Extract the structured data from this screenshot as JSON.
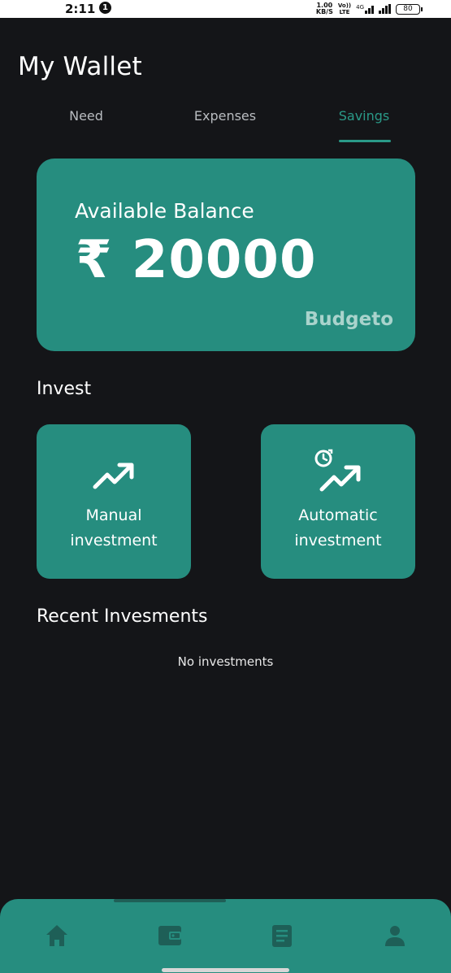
{
  "status_bar": {
    "time": "2:11",
    "notification_count": "1",
    "net_speed_value": "1.00",
    "net_speed_unit": "KB/S",
    "volte_top": "Vo))",
    "volte_bottom": "LTE",
    "network_type": "4G",
    "battery": "80"
  },
  "header": {
    "title": "My Wallet"
  },
  "tabs": [
    {
      "label": "Need",
      "active": false
    },
    {
      "label": "Expenses",
      "active": false
    },
    {
      "label": "Savings",
      "active": true
    }
  ],
  "balance_card": {
    "label": "Available Balance",
    "amount": "₹ 20000",
    "brand": "Budgeto"
  },
  "invest": {
    "title": "Invest",
    "tiles": [
      {
        "line1": "Manual",
        "line2": "investment",
        "icon": "trending-up-icon"
      },
      {
        "line1": "Automatic",
        "line2": "investment",
        "icon": "auto-trending-up-icon"
      }
    ]
  },
  "recent": {
    "title": "Recent Invesments",
    "empty_text": "No investments"
  },
  "bottom_nav": {
    "items": [
      {
        "icon": "home-icon"
      },
      {
        "icon": "wallet-icon"
      },
      {
        "icon": "document-icon"
      },
      {
        "icon": "profile-icon"
      }
    ]
  },
  "colors": {
    "background": "#141518",
    "accent": "#268d7f",
    "accent_text": "#2a9a88",
    "nav_icon": "#1e5f57"
  }
}
